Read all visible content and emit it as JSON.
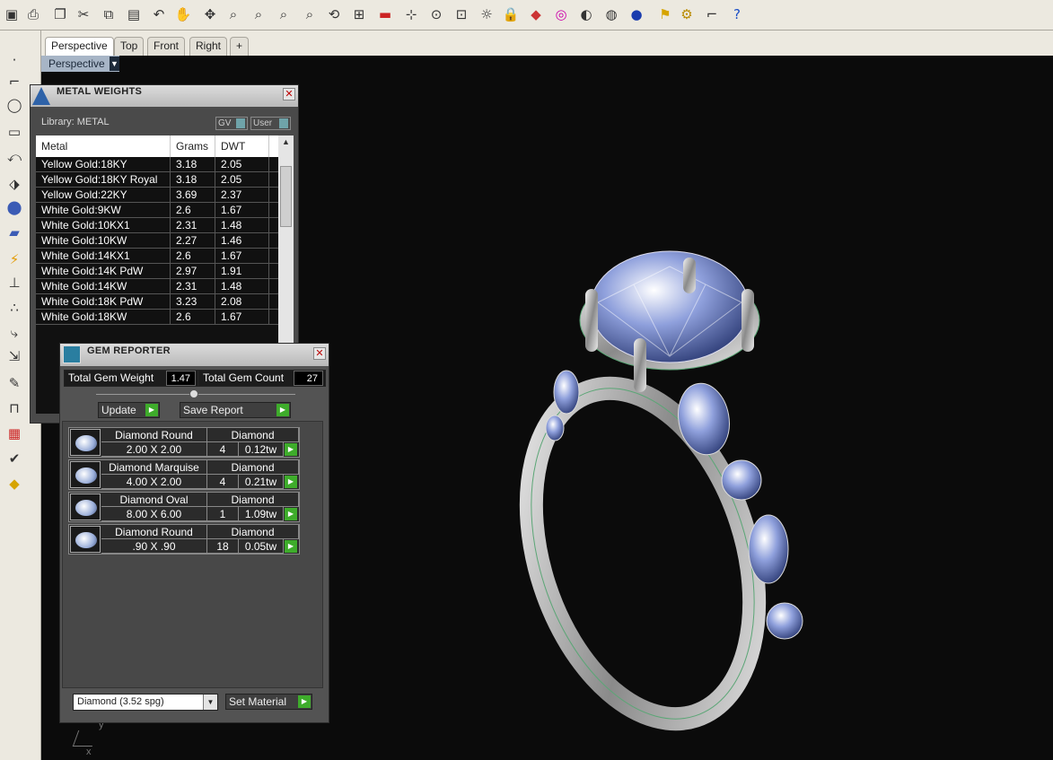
{
  "tabs": [
    {
      "label": "Perspective",
      "active": true
    },
    {
      "label": "Top"
    },
    {
      "label": "Front"
    },
    {
      "label": "Right"
    },
    {
      "label": "+"
    }
  ],
  "viewport": {
    "label": "Perspective",
    "axis_y": "y",
    "axis_x": "x"
  },
  "metal_weights": {
    "title": "METAL WEIGHTS",
    "library_label": "Library: METAL",
    "gv_label": "GV",
    "user_label": "User",
    "columns": [
      "Metal",
      "Grams",
      "DWT"
    ],
    "rows": [
      {
        "metal": "Yellow Gold:18KY",
        "grams": "3.18",
        "dwt": "2.05"
      },
      {
        "metal": "Yellow Gold:18KY Royal",
        "grams": "3.18",
        "dwt": "2.05"
      },
      {
        "metal": "Yellow Gold:22KY",
        "grams": "3.69",
        "dwt": "2.37"
      },
      {
        "metal": "White Gold:9KW",
        "grams": "2.6",
        "dwt": "1.67"
      },
      {
        "metal": "White Gold:10KX1",
        "grams": "2.31",
        "dwt": "1.48"
      },
      {
        "metal": "White Gold:10KW",
        "grams": "2.27",
        "dwt": "1.46"
      },
      {
        "metal": "White Gold:14KX1",
        "grams": "2.6",
        "dwt": "1.67"
      },
      {
        "metal": "White Gold:14K PdW",
        "grams": "2.97",
        "dwt": "1.91"
      },
      {
        "metal": "White Gold:14KW",
        "grams": "2.31",
        "dwt": "1.48"
      },
      {
        "metal": "White Gold:18K PdW",
        "grams": "3.23",
        "dwt": "2.08"
      },
      {
        "metal": "White Gold:18KW",
        "grams": "2.6",
        "dwt": "1.67"
      }
    ]
  },
  "gem_reporter": {
    "title": "GEM REPORTER",
    "total_weight_label": "Total Gem Weight",
    "total_weight_value": "1.47",
    "total_count_label": "Total Gem Count",
    "total_count_value": "27",
    "update_label": "Update",
    "save_report_label": "Save Report",
    "gems": [
      {
        "shape": "Diamond Round",
        "size": "2.00 X 2.00",
        "material": "Diamond",
        "count": "4",
        "tw": "0.12tw"
      },
      {
        "shape": "Diamond Marquise",
        "size": "4.00 X 2.00",
        "material": "Diamond",
        "count": "4",
        "tw": "0.21tw"
      },
      {
        "shape": "Diamond Oval",
        "size": "8.00 X 6.00",
        "material": "Diamond",
        "count": "1",
        "tw": "1.09tw"
      },
      {
        "shape": "Diamond Round",
        "size": ".90 X .90",
        "material": "Diamond",
        "count": "18",
        "tw": "0.05tw"
      }
    ],
    "material_select": "Diamond      (3.52 spg)",
    "set_material_label": "Set Material"
  },
  "colors": {
    "viewport_bg": "#0b0b0b",
    "panel_bg": "#4a4a4a",
    "play_green": "#3eac2b",
    "stone_blue": "#7d8fd6"
  }
}
